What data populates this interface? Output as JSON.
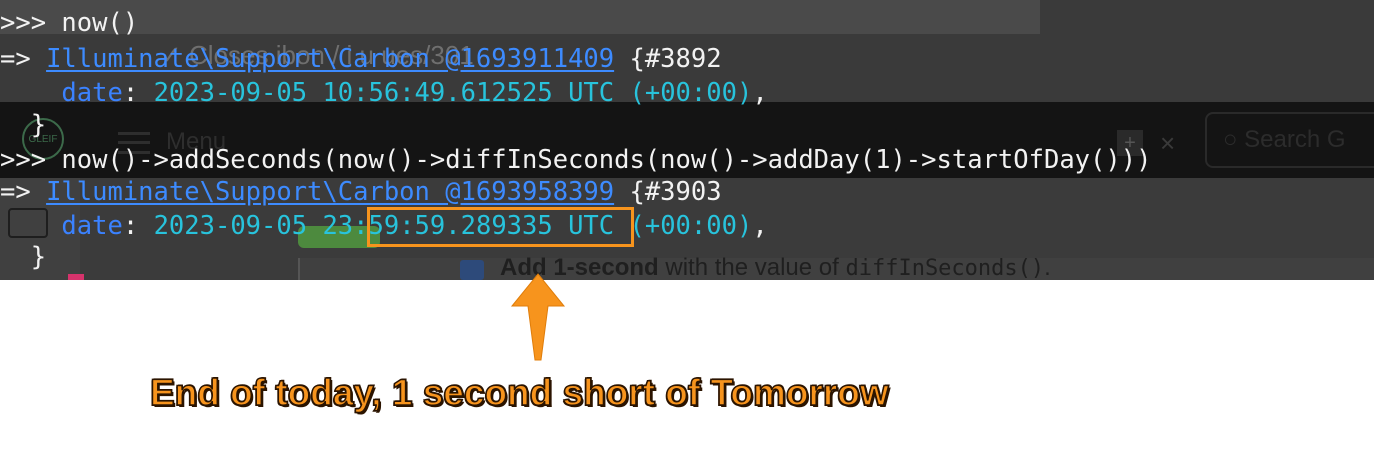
{
  "background_page": {
    "url_fragment": "✓ Closes   ibon  / i   u  ues/301",
    "menu_label": "Menu",
    "logo_text": "GLEIF",
    "search_placeholder": "Search G",
    "checkbox_text_bold": "Add 1-second",
    "checkbox_text_rest": " with the value of ",
    "checkbox_code": "diffInSeconds()",
    "checkbox_tail": "."
  },
  "terminal": {
    "line1": {
      "prompt": ">>> ",
      "command": "now()"
    },
    "line2": {
      "arrow": "=> ",
      "class_link": "Illuminate\\Support\\Carbon @1693911409",
      "object_id": " {#3892"
    },
    "line3": {
      "indent": "    ",
      "key": "date",
      "sep": ": ",
      "value": "2023-09-05 10:56:49.612525 UTC (+00:00)",
      "trail": ","
    },
    "line4": {
      "indent": "  ",
      "brace": "}"
    },
    "line5": {
      "prompt": ">>> ",
      "command": "now()->addSeconds(now()->diffInSeconds(now()->addDay(1)->startOfDay()))"
    },
    "line6": {
      "arrow": "=> ",
      "class_link": "Illuminate\\Support\\Carbon @1693958399",
      "object_id": " {#3903"
    },
    "line7": {
      "indent": "    ",
      "key": "date",
      "sep": ": ",
      "value": "2023-09-05 23:59:59.289335 UTC (+00:00)",
      "trail": ","
    },
    "line8": {
      "indent": "  ",
      "brace": "}"
    }
  },
  "annotation": {
    "highlighted_text": "23:59:59.289335",
    "caption": "End of today, 1 second short of Tomorrow",
    "color": "#f7941d"
  },
  "colors": {
    "terminal_text": "#f2f2f2",
    "key_cyan": "#28c3dc",
    "link_blue": "#3d8bff",
    "annotation_orange": "#f7941d"
  }
}
